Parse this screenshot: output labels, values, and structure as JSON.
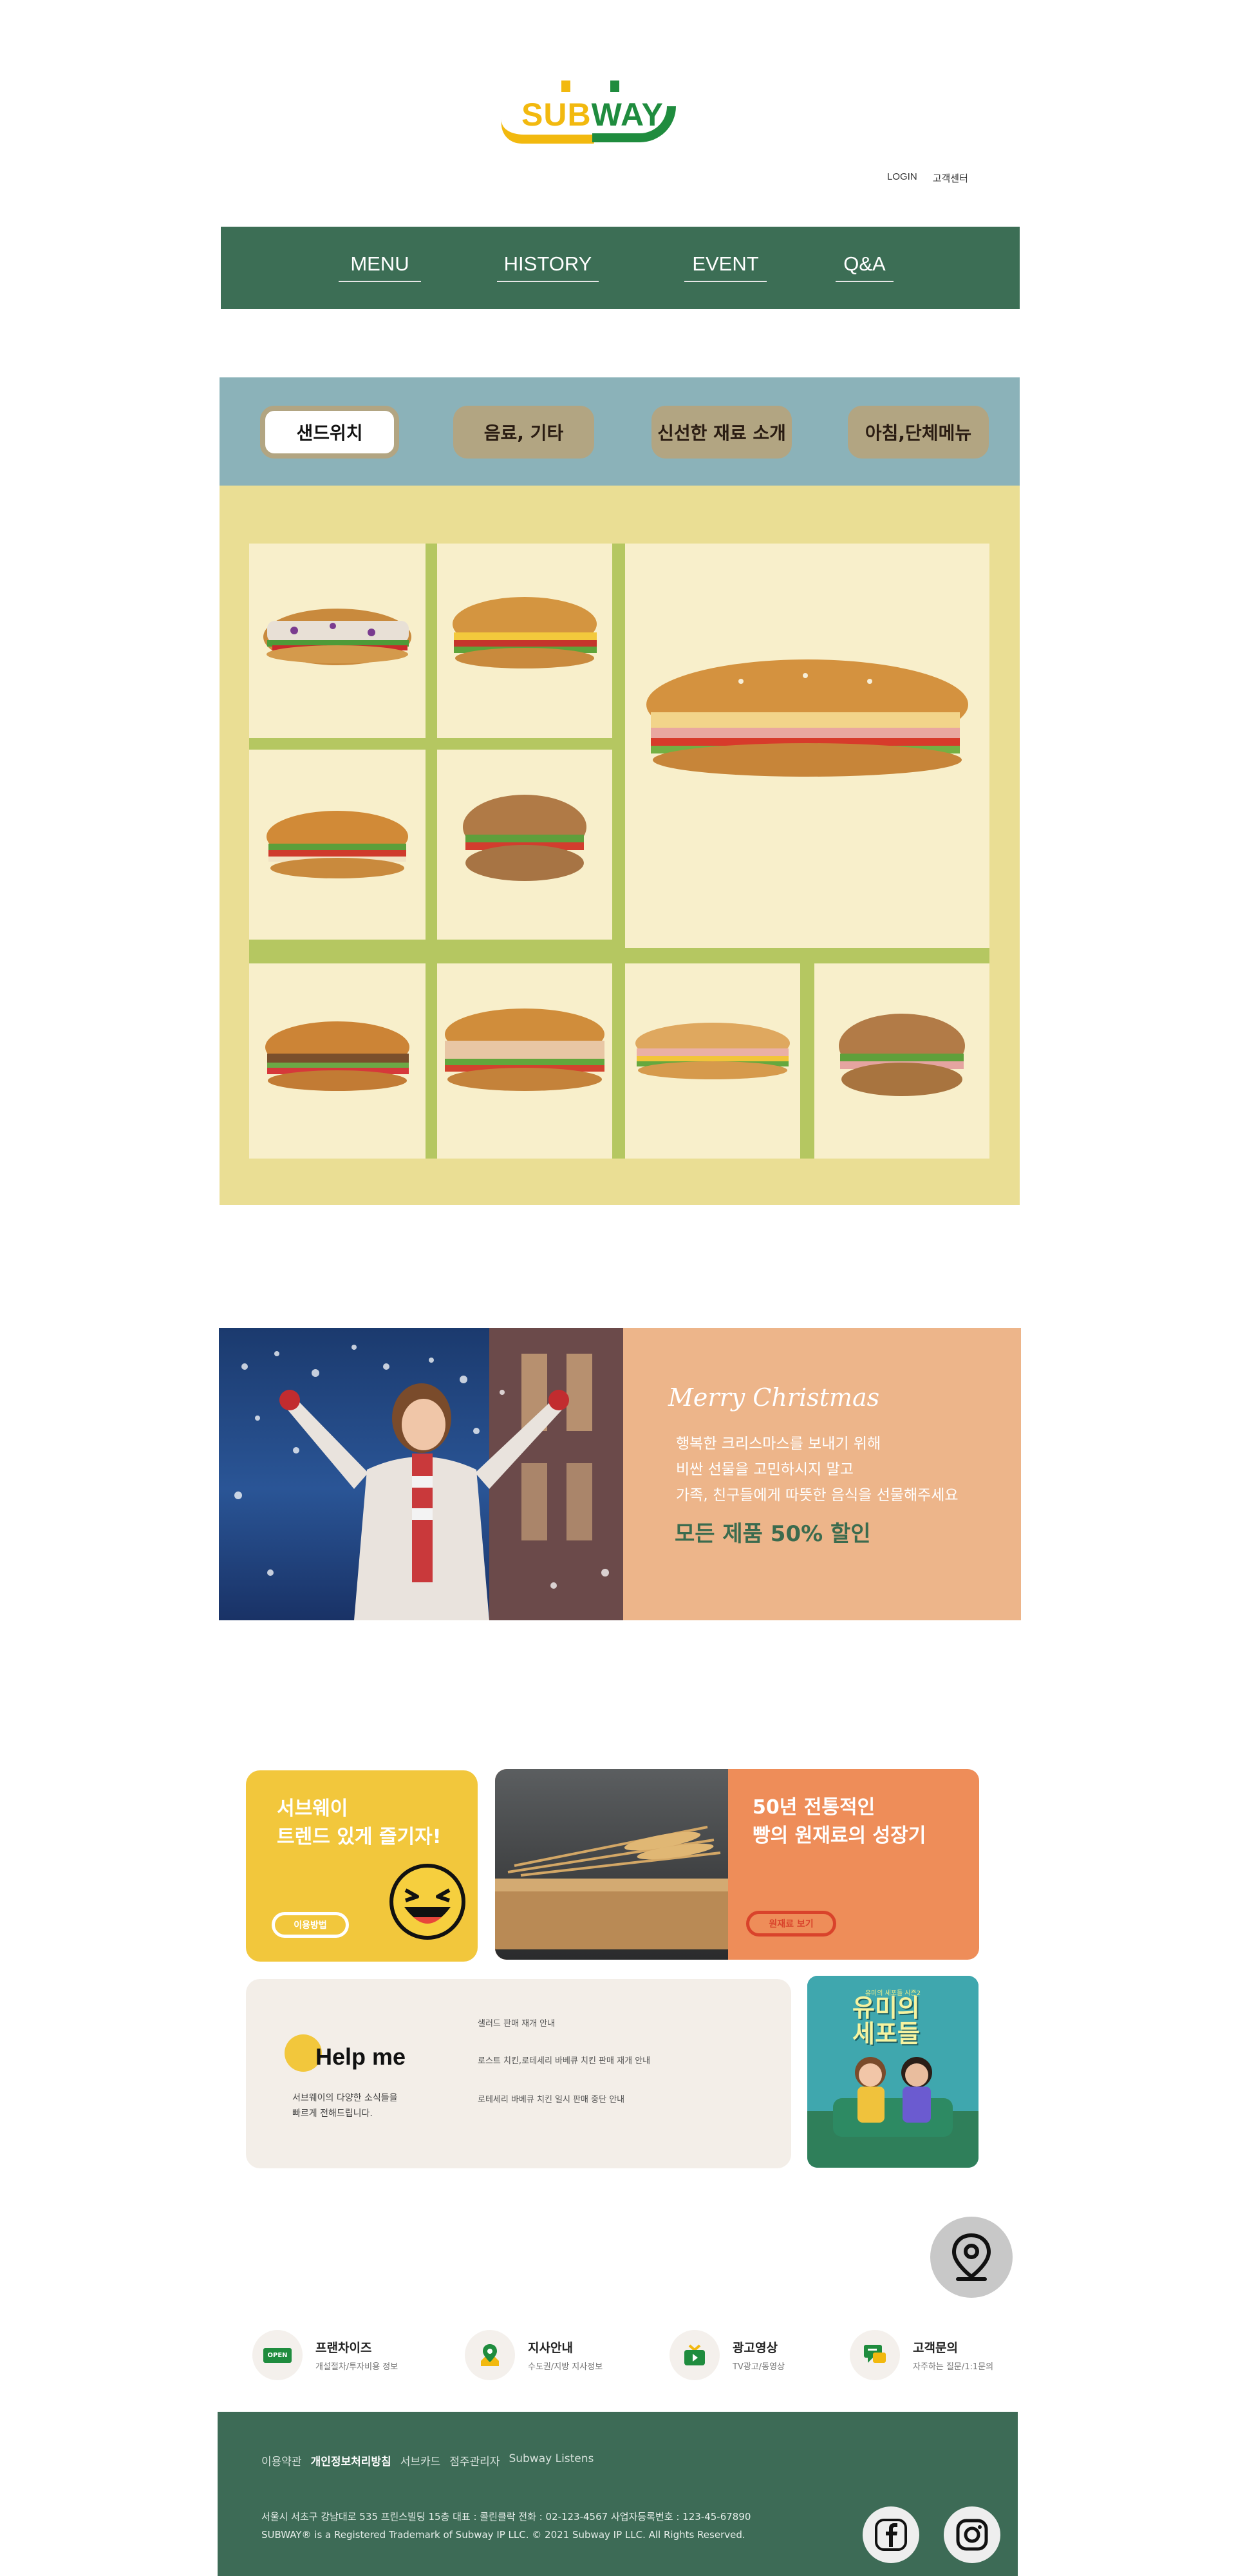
{
  "brand": {
    "logo_sub": "SUB",
    "logo_way": "WAY"
  },
  "top_links": {
    "login": "LOGIN",
    "customer": "고객센터"
  },
  "nav": {
    "items": [
      "MENU",
      "HISTORY",
      "EVENT",
      "Q&A"
    ]
  },
  "menu_tabs": {
    "items": [
      "샌드위치",
      "음료, 기타",
      "신선한 재료 소개",
      "아침,단체메뉴"
    ],
    "active": "샌드위치"
  },
  "promo": {
    "title": "Merry Christmas",
    "lines": [
      "행복한 크리스마스를 보내기 위해",
      "비싼 선물을 고민하시지 말고",
      "가족, 친구들에게 따뜻한 음식을 선물해주세요"
    ],
    "highlight": "모든 제품 50% 할인"
  },
  "cards": {
    "trend": {
      "title_1": "서브웨이",
      "title_2": "트렌드 있게 즐기자!",
      "button": "이용방법"
    },
    "bread": {
      "title_1": "50년 전통적인",
      "title_2": "빵의 원재료의 성장기",
      "button": "원재료 보기"
    },
    "help": {
      "title": "Help me",
      "desc_1": "서브웨이의 다양한 소식들을",
      "desc_2": "빠르게 전해드립니다.",
      "notices": [
        "샐러드 판매 재개 안내",
        "로스트 치킨,로테세리 바베큐 치킨 판매 재개 안내",
        "로테세리 바베큐 치킨 일시 판매 중단 안내"
      ]
    },
    "poster": {
      "title_1": "유미의",
      "title_2": "세포들",
      "small": "유미의 세포들 시즌2"
    }
  },
  "services": [
    {
      "title": "프랜차이즈",
      "sub": "개설절차/투자비용 정보",
      "icon": "open-sign-icon",
      "badge": "OPEN"
    },
    {
      "title": "지사안내",
      "sub": "수도권/지방 지사정보",
      "icon": "map-pin-icon"
    },
    {
      "title": "광고영상",
      "sub": "TV광고/동영상",
      "icon": "tv-icon"
    },
    {
      "title": "고객문의",
      "sub": "자주하는 질문/1:1문의",
      "icon": "chat-icon"
    }
  ],
  "footer": {
    "links": [
      "이용약관",
      "개인정보처리방침",
      "서브카드",
      "점주관리자",
      "Subway Listens"
    ],
    "address": "서울시 서초구 강남대로 535 프린스빌딩 15층  대표 : 콜린클락  전화 : 02-123-4567  사업자등록번호 : 123-45-67890",
    "copyright": "SUBWAY® is a Registered Trademark of Subway IP LLC. © 2021 Subway IP LLC. All Rights Reserved."
  },
  "colors": {
    "nav_green": "#3c6e55",
    "subway_yellow": "#f2b90f",
    "subway_green": "#1f8c3e",
    "menu_bg": "#eade94",
    "tab_bar": "#8bb2b9",
    "promo_peach": "#edb58a",
    "promo_green_text": "#3b6b4e"
  }
}
